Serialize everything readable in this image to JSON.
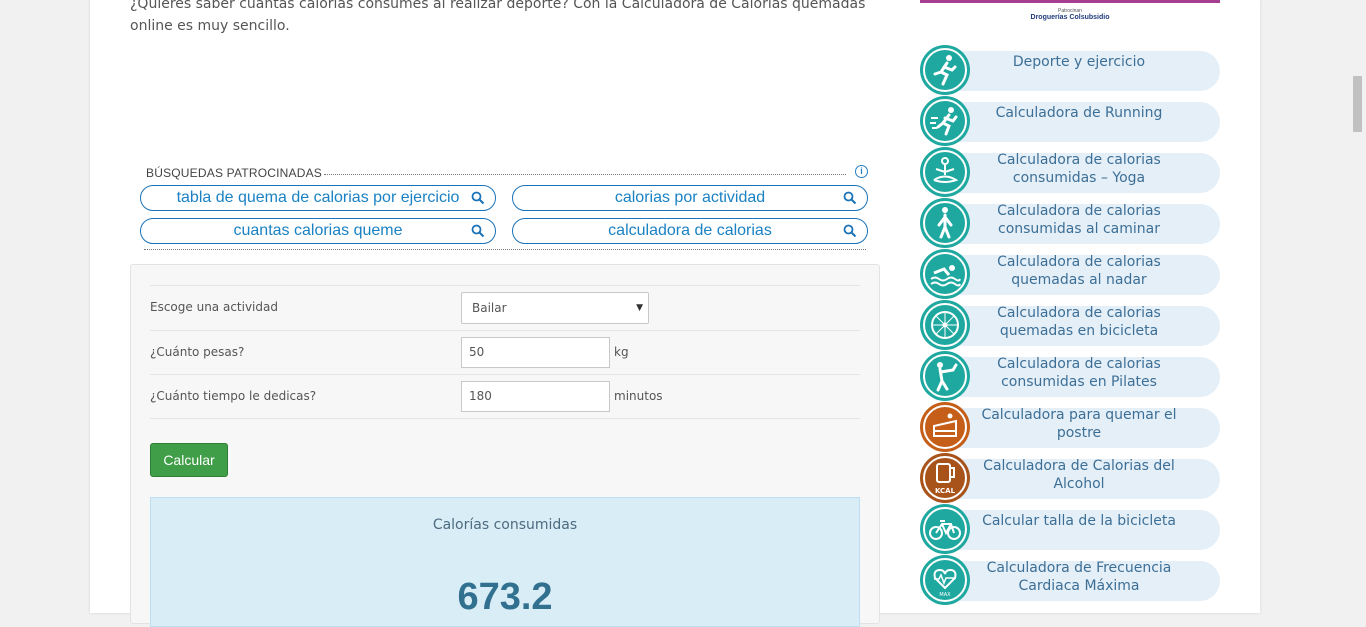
{
  "intro": {
    "text": "¿Quieres saber cuantas calorias consumes al realizar deporte? Con la Calculadora de Calorias quemadas online es muy sencillo."
  },
  "sponsored": {
    "heading": "BÚSQUEDAS PATROCINADAS",
    "items": [
      "tabla de quema de calorias por ejercicio",
      "calorias por actividad",
      "cuantas calorias queme",
      "calculadora de calorias"
    ]
  },
  "form": {
    "activity_label": "Escoge una actividad",
    "activity_value": "Bailar",
    "weight_label": "¿Cuánto pesas?",
    "weight_value": "50",
    "weight_unit": "kg",
    "time_label": "¿Cuánto tiempo le dedicas?",
    "time_value": "180",
    "time_unit": "minutos",
    "submit_label": "Calcular"
  },
  "result": {
    "label": "Calorías consumidas",
    "value": "673.2"
  },
  "banner": {
    "caption": "Patrocinan",
    "brand": "Droguerías Colsubsidio",
    "bar_color": "#a53e8f"
  },
  "sidebar": {
    "items": [
      {
        "label": "Deporte y ejercicio",
        "icon": "running-icon",
        "color": "#1fa89f"
      },
      {
        "label": "Calculadora de Running",
        "icon": "sprint-icon",
        "color": "#1fa89f"
      },
      {
        "label": "Calculadora de calorias consumidas – Yoga",
        "icon": "yoga-icon",
        "color": "#1fa89f"
      },
      {
        "label": "Calculadora de calorias consumidas al caminar",
        "icon": "walking-icon",
        "color": "#1fa89f"
      },
      {
        "label": "Calculadora de calorias quemadas al nadar",
        "icon": "swimming-icon",
        "color": "#1fa89f"
      },
      {
        "label": "Calculadora de calorias quemadas en bicicleta",
        "icon": "bike-wheel-icon",
        "color": "#1fa89f"
      },
      {
        "label": "Calculadora de calorias consumidas en Pilates",
        "icon": "pilates-icon",
        "color": "#1fa89f"
      },
      {
        "label": "Calculadora para quemar el postre",
        "icon": "cake-icon",
        "color": "#c55e18"
      },
      {
        "label": "Calculadora de Calorias del Alcohol",
        "icon": "beer-kcal-icon",
        "color": "#a8531a"
      },
      {
        "label": "Calcular talla de la bicicleta",
        "icon": "bicycle-icon",
        "color": "#1fa89f"
      },
      {
        "label": "Calculadora de Frecuencia Cardiaca Máxima",
        "icon": "heart-max-icon",
        "color": "#1fa89f"
      }
    ]
  }
}
